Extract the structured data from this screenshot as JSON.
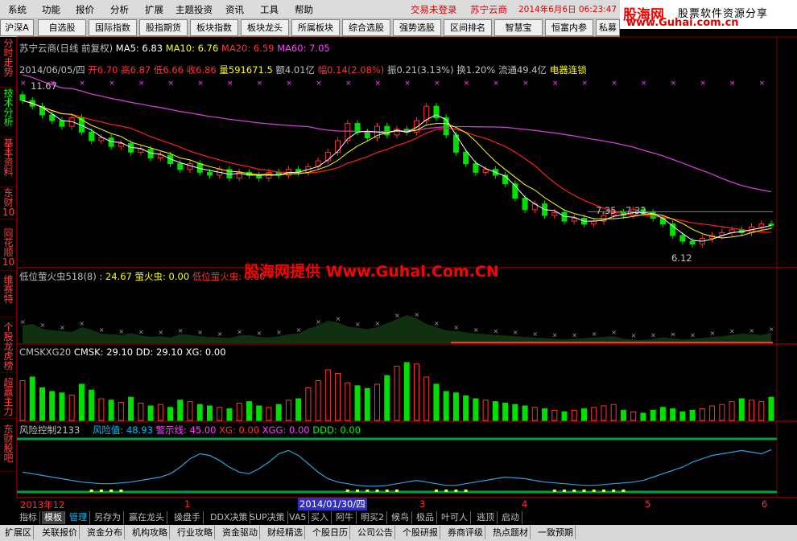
{
  "menu": [
    "系统",
    "功能",
    "报价",
    "分析",
    "扩展",
    "主题投资",
    "资讯",
    "工具",
    "帮助"
  ],
  "login_status": "交易未登录",
  "stock_title": "苏宁云商",
  "datetime": "2014年6月6日 06:23:47",
  "brand": {
    "title": "股海网",
    "subtitle": "股票软件资源分享",
    "url": "www.Guhai.com.cn"
  },
  "toolbar": [
    "沪深A股",
    "自选股",
    "国际指数",
    "股指期货",
    "板块指数",
    "板块龙头",
    "所属板块",
    "综合选股",
    "强势选股",
    "区间排名",
    "智慧宝",
    "恒富内参",
    "私募"
  ],
  "side_tabs": [
    {
      "label": "分时走势",
      "active": false
    },
    {
      "label": "技术分析",
      "active": true
    },
    {
      "label": "基本资料",
      "active": false
    },
    {
      "label": "东财10",
      "active": false
    },
    {
      "label": "同花顺10",
      "active": false
    },
    {
      "label": "维赛特",
      "active": false
    },
    {
      "label": "个股龙虎榜",
      "active": false
    },
    {
      "label": "超赢主力",
      "active": false
    },
    {
      "label": "东财股吧",
      "active": false
    }
  ],
  "main_info": {
    "name": "苏宁云商(日线 前复权)",
    "ma5": "MA5: 6.83",
    "ma10": "MA10: 6.76",
    "ma20": "MA20: 6.59",
    "ma60": "MA60: 7.05"
  },
  "quote": {
    "date": "2014/06/05/四",
    "open": "开6.70",
    "high": "高6.87",
    "low": "低6.66",
    "close": "收6.86",
    "volume": "量591671.5",
    "amount": "额4.01亿",
    "change": "幅0.14(2.08%)",
    "amplitude": "振0.21(3.13%)",
    "turnover": "换1.20%",
    "float": "流通49.4亿",
    "sector": "电器连锁"
  },
  "price_labels": {
    "high": "11.67",
    "range": "7.35 - 7.32",
    "low": "6.12"
  },
  "ind1": {
    "title": "低位萤火虫518(8)",
    "v1": ": 24.67",
    "v2": "萤火虫: 0.00",
    "v3": "低位萤火虫: 0.00"
  },
  "watermark": "股海网提供 Www.Guhai.Com.CN",
  "ind2": {
    "title": "CMSKXG20",
    "cmsk": "CMSK: 29.10",
    "dd": "DD: 29.10",
    "xg": "XG: 0.00"
  },
  "ind3": {
    "title": "风险控制2133",
    "risk": "风险值: 48.93",
    "warn": "警示线: 45.00",
    "xg": "XG: 0.00",
    "xgg": "XGG: 0.00",
    "ddd": "DDD: 0.00"
  },
  "time_axis": {
    "start": "2013年12",
    "m1": "1",
    "cursor": "2014/01/30/四",
    "m3": "3",
    "m4": "4",
    "m5": "5",
    "m6": "6"
  },
  "tabs1": [
    "指标",
    "模板",
    "管理",
    "另存为",
    "赢在龙头",
    "操盘手",
    "DDX决策",
    "SUP决策",
    "VA5",
    "买入",
    "阿牛",
    "明买2",
    "候鸟",
    "极品",
    "叶可人",
    "逃顶",
    "启动"
  ],
  "tabs2": [
    "扩展区",
    "关联报价",
    "资金分布",
    "机构攻略",
    "行业攻略",
    "资金驱动",
    "财经精选",
    "个股日历",
    "公司公告",
    "个股研报",
    "券商评级",
    "热点题材",
    "一致预期"
  ],
  "colors": {
    "up": "#ff3232",
    "down": "#00e000",
    "ma5": "#ffffff",
    "ma10": "#ffff00",
    "ma20": "#ff2020",
    "ma60": "#d040d0",
    "cyan": "#00ffff",
    "magenta": "#ff40ff"
  },
  "chart_data": {
    "type": "candlestick",
    "closes": [
      11.2,
      11.0,
      10.7,
      10.5,
      10.3,
      10.6,
      10.1,
      9.8,
      9.9,
      9.6,
      9.7,
      9.4,
      9.5,
      9.2,
      9.3,
      9.0,
      8.8,
      9.0,
      8.7,
      8.6,
      8.8,
      8.5,
      8.7,
      8.6,
      8.5,
      8.7,
      8.6,
      8.8,
      8.7,
      8.9,
      9.1,
      9.4,
      9.8,
      10.4,
      10.1,
      9.9,
      10.3,
      10.0,
      10.2,
      10.1,
      10.5,
      11.0,
      10.6,
      10.0,
      9.4,
      9.0,
      8.7,
      8.8,
      8.6,
      8.3,
      7.8,
      7.4,
      7.6,
      7.2,
      7.3,
      7.0,
      7.1,
      6.9,
      7.0,
      7.2,
      7.3,
      7.2,
      7.4,
      7.3,
      7.1,
      6.9,
      6.5,
      6.3,
      6.2,
      6.4,
      6.5,
      6.6,
      6.7,
      6.6,
      6.8,
      6.9,
      6.86
    ],
    "volumes": [
      55,
      60,
      45,
      40,
      38,
      35,
      50,
      42,
      30,
      28,
      25,
      32,
      24,
      20,
      22,
      18,
      28,
      26,
      22,
      20,
      18,
      16,
      24,
      26,
      20,
      18,
      22,
      28,
      30,
      45,
      55,
      70,
      65,
      52,
      48,
      44,
      50,
      62,
      75,
      92,
      78,
      60,
      50,
      40,
      38,
      34,
      30,
      28,
      26,
      24,
      22,
      20,
      18,
      16,
      14,
      12,
      14,
      16,
      18,
      20,
      22,
      14,
      12,
      10,
      14,
      18,
      16,
      12,
      14,
      16,
      20,
      22,
      26,
      30,
      28,
      26,
      32
    ],
    "risk": [
      22,
      20,
      18,
      16,
      14,
      12,
      10,
      9,
      8,
      8,
      9,
      10,
      12,
      14,
      16,
      20,
      28,
      38,
      44,
      42,
      36,
      28,
      22,
      20,
      26,
      34,
      44,
      48,
      42,
      32,
      22,
      14,
      10,
      8,
      6,
      5,
      5,
      6,
      8,
      10,
      12,
      10,
      8,
      6,
      6,
      8,
      10,
      12,
      14,
      16,
      15,
      14,
      12,
      10,
      9,
      8,
      7,
      6,
      6,
      7,
      8,
      9,
      10,
      12,
      16,
      20,
      24,
      28,
      34,
      38,
      42,
      44,
      46,
      48,
      46,
      44,
      48.93
    ]
  }
}
